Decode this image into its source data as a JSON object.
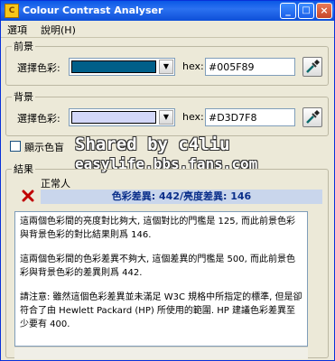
{
  "window": {
    "title": "Colour Contrast Analyser",
    "minimize": "_",
    "maximize": "□",
    "close": "×"
  },
  "menu": {
    "options": "選項",
    "help": "說明",
    "help_key": "(H)"
  },
  "foreground": {
    "legend": "前景",
    "select_label": "選擇色彩:",
    "hex_label": "hex:",
    "hex_value": "#005F89",
    "color": "#005F89"
  },
  "background": {
    "legend": "背景",
    "select_label": "選擇色彩:",
    "hex_label": "hex:",
    "hex_value": "#D3D7F8",
    "color": "#D3D7F8"
  },
  "show_options": {
    "label": "顯示色盲",
    "checked": false
  },
  "watermark": {
    "line1": "Shared by c4liu",
    "line2": "easylife.bbs.fans.com"
  },
  "result": {
    "legend": "結果",
    "category": "正常人",
    "summary": "色彩差異: 442/亮度差異: 146",
    "status_icon": "fail-x-icon",
    "paragraphs": [
      "這兩個色彩間的亮度對比夠大, 這個對比的門檻是 125, 而此前景色彩與背景色彩的對比結果則爲 146.",
      "這兩個色彩間的色彩差異不夠大, 這個差異的門檻是 500, 而此前景色彩與背景色彩的差異則爲 442.",
      "請注意: 雖然這個色彩差異並未滿足 W3C 規格中所指定的標準, 但是卻符合了由 Hewlett Packard (HP) 所使用的範圍. HP 建議色彩差異至少要有 400."
    ]
  },
  "colors": {
    "titlebar": "#0a58e6",
    "fail": "#c00000",
    "result_bar": "#c9d6ec"
  }
}
